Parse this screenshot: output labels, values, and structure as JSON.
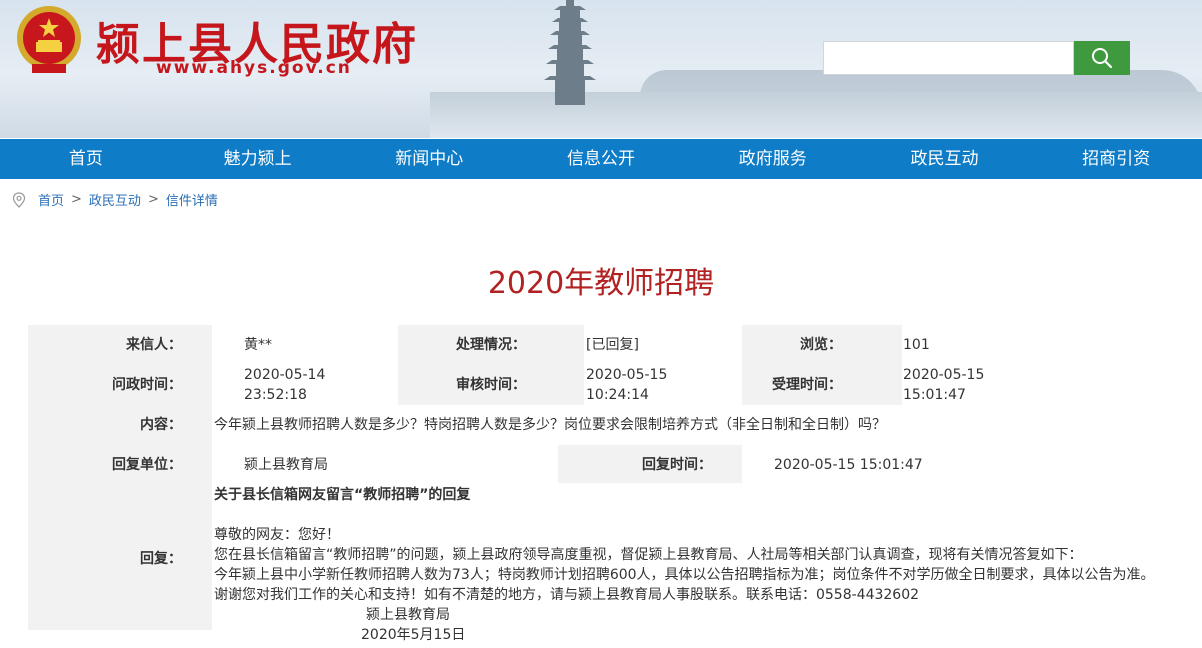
{
  "header": {
    "site_title": "颍上县人民政府",
    "site_url": "www.ahys.gov.cn",
    "search_placeholder": ""
  },
  "nav": {
    "items": [
      "首页",
      "魅力颍上",
      "新闻中心",
      "信息公开",
      "政府服务",
      "政民互动",
      "招商引资"
    ]
  },
  "breadcrumb": {
    "items": [
      "首页",
      "政民互动",
      "信件详情"
    ],
    "separator": ">"
  },
  "page_title": "2020年教师招聘",
  "details": {
    "sender_label": "来信人：",
    "sender": "黄**",
    "status_label": "处理情况：",
    "status": "[已回复]",
    "views_label": "浏览：",
    "views": "101",
    "ask_time_label": "问政时间：",
    "ask_date": "2020-05-14",
    "ask_time": "23:52:18",
    "review_time_label": "审核时间：",
    "review_date": "2020-05-15",
    "review_time": "10:24:14",
    "accept_time_label": "受理时间：",
    "accept_date": "2020-05-15",
    "accept_time": "15:01:47",
    "content_label": "内容：",
    "content": "今年颍上县教师招聘人数是多少？特岗招聘人数是多少？岗位要求会限制培养方式（非全日制和全日制）吗？",
    "reply_unit_label": "回复单位：",
    "reply_unit": "颍上县教育局",
    "reply_time_label": "回复时间：",
    "reply_time": "2020-05-15 15:01:47",
    "reply_label": "回复：",
    "reply": {
      "heading": "关于县长信箱网友留言“教师招聘”的回复",
      "greeting": "尊敬的网友：您好！",
      "line1": "您在县长信箱留言“教师招聘”的问题，颍上县政府领导高度重视，督促颍上县教育局、人社局等相关部门认真调查，现将有关情况答复如下：",
      "line2": "今年颍上县中小学新任教师招聘人数为73人；特岗教师计划招聘600人，具体以公告招聘指标为准；岗位条件不对学历做全日制要求，具体以公告为准。",
      "line3": "谢谢您对我们工作的关心和支持！如有不清楚的地方，请与颍上县教育局人事股联系。联系电话：0558-4432602",
      "signature": "颍上县教育局",
      "date": "2020年5月15日"
    }
  },
  "colors": {
    "nav_bg": "#0e7cc6",
    "title_red": "#b22222",
    "brand_red": "#c5161c",
    "search_green": "#3f9a3f",
    "label_bg": "#f2f2f2"
  }
}
